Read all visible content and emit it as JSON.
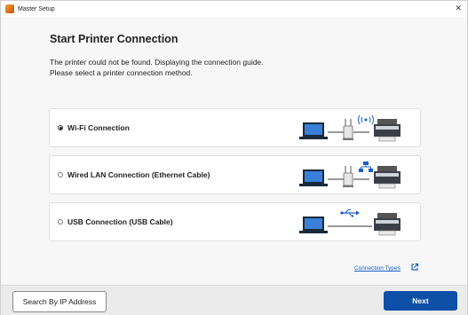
{
  "window": {
    "title": "Master Setup"
  },
  "main": {
    "heading": "Start Printer Connection",
    "message_line1": "The printer could not be found. Displaying the connection guide.",
    "message_line2": "Please select a printer connection method."
  },
  "options": [
    {
      "label": "Wi-Fi Connection",
      "selected": true
    },
    {
      "label": "Wired LAN Connection (Ethernet Cable)",
      "selected": false
    },
    {
      "label": "USB Connection (USB Cable)",
      "selected": false
    }
  ],
  "link": {
    "connection_types": "Connection Types"
  },
  "footer": {
    "search_ip": "Search By IP Address",
    "next": "Next"
  },
  "colors": {
    "accent": "#0e4fa8",
    "link": "#1a5dc8"
  }
}
